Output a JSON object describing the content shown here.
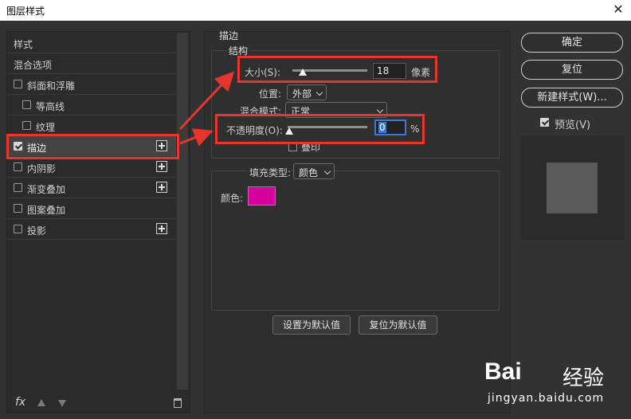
{
  "window": {
    "title": "图层样式",
    "close_glyph": "✕"
  },
  "left_panel": {
    "items": [
      {
        "label": "样式"
      },
      {
        "label": "混合选项"
      },
      {
        "label": "斜面和浮雕",
        "checked": false
      },
      {
        "label": "等高线",
        "checked": false
      },
      {
        "label": "纹理",
        "checked": false
      },
      {
        "label": "描边",
        "checked": true,
        "selected": true
      },
      {
        "label": "内阴影",
        "checked": false
      },
      {
        "label": "渐变叠加",
        "checked": false
      },
      {
        "label": "图案叠加",
        "checked": false
      },
      {
        "label": "投影",
        "checked": false
      }
    ],
    "footer": {
      "fx_label": "fx"
    }
  },
  "stroke": {
    "section_title": "描边",
    "structure_title": "结构",
    "size_label": "大小(S):",
    "size_value": "18",
    "size_unit": "像素",
    "size_slider_fraction": 0.08,
    "position_label": "位置:",
    "position_value": "外部",
    "blend_label": "混合模式:",
    "blend_value": "正常",
    "opacity_label": "不透明度(O):",
    "opacity_value": "0",
    "opacity_unit": "%",
    "opacity_slider_fraction": 0.0,
    "overprint_label": "叠印",
    "fill_type_label": "填充类型:",
    "fill_type_value": "颜色",
    "color_label": "颜色:",
    "color_value": "#d5009d",
    "set_default_button": "设置为默认值",
    "reset_default_button": "复位为默认值"
  },
  "right_panel": {
    "ok_button": "确定",
    "reset_button": "复位",
    "new_style_button": "新建样式(W)...",
    "preview_label": "预览(V)",
    "preview_checked": true
  },
  "colors": {
    "annotation_red": "#e7352e",
    "accent_blue": "#3b7bd6"
  },
  "watermark": {
    "brand": "Bai",
    "brand_suffix": "经验",
    "url": "jingyan.baidu.com"
  }
}
